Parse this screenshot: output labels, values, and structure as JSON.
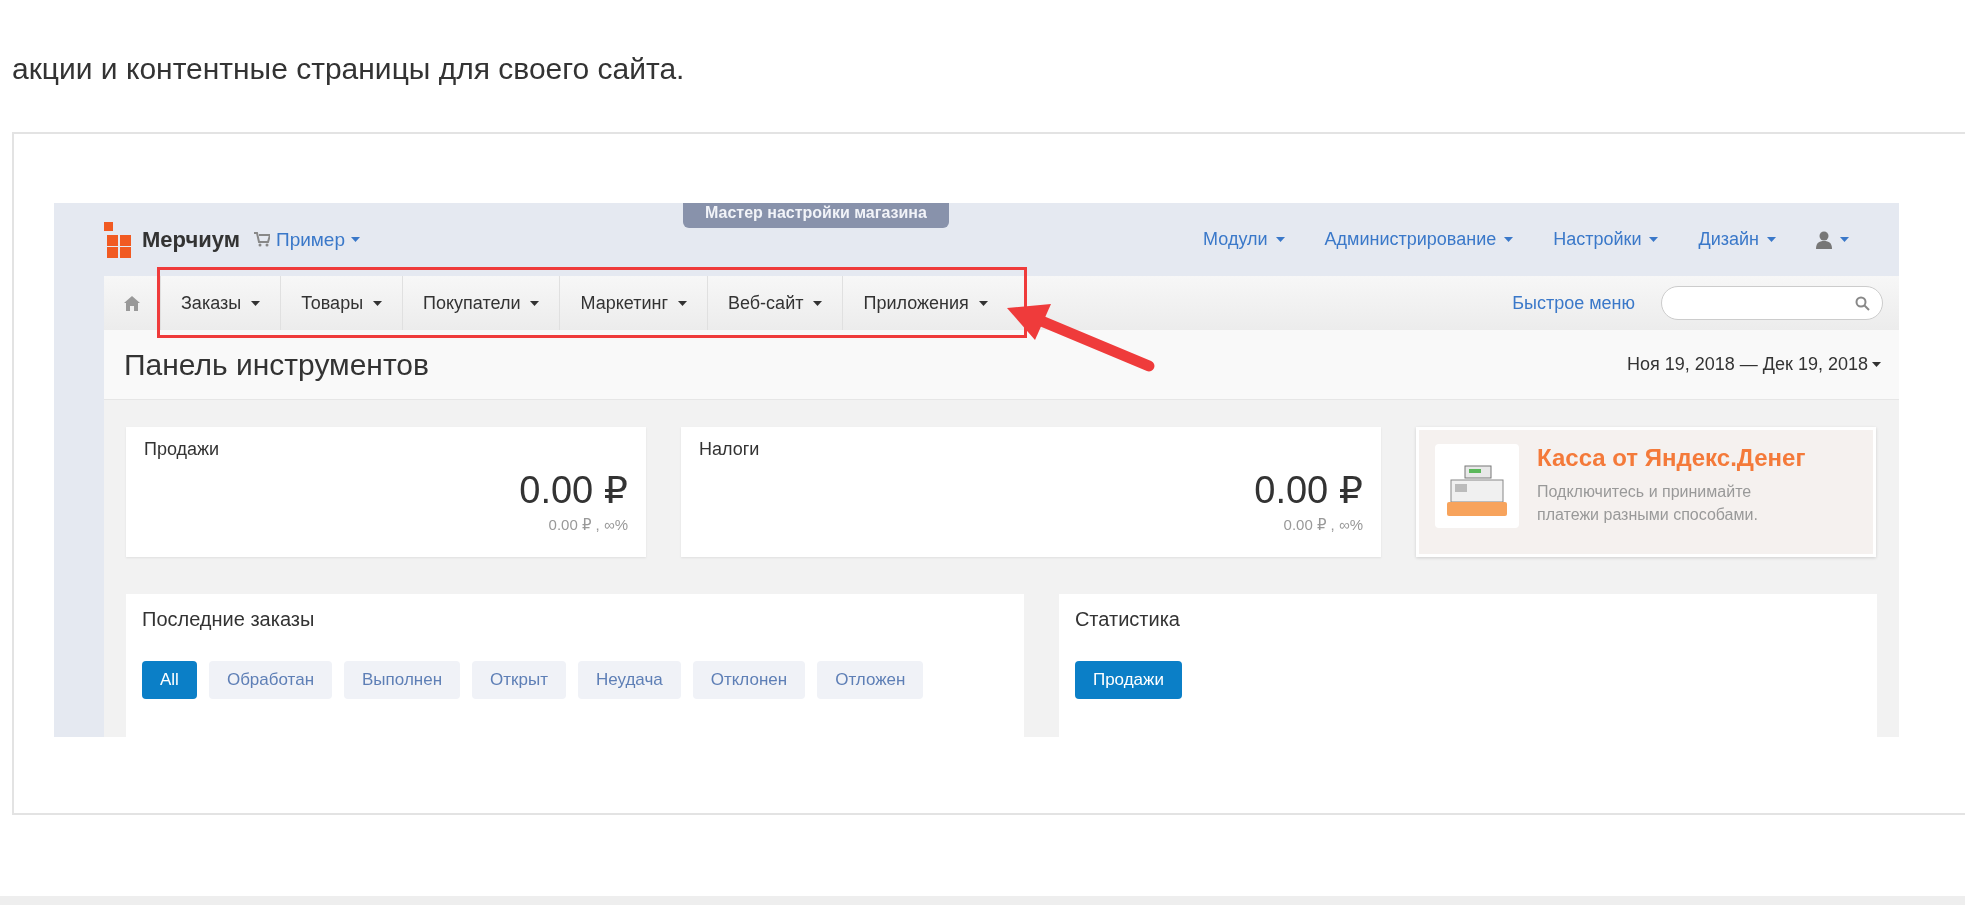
{
  "article": {
    "text": "акции и контентные страницы для своего сайта."
  },
  "screenshot": {
    "wizard_button": "Мастер настройки магазина",
    "brand": "Мерчиум",
    "store": "Пример",
    "top_menu": [
      "Модули",
      "Администрирование",
      "Настройки",
      "Дизайн"
    ],
    "nav": [
      "Заказы",
      "Товары",
      "Покупатели",
      "Маркетинг",
      "Веб-сайт",
      "Приложения"
    ],
    "quick_menu": "Быстрое меню",
    "page_title": "Панель инструментов",
    "date_range": "Ноя 19, 2018 — Дек 19, 2018",
    "stats": [
      {
        "label": "Продажи",
        "value": "0.00 ₽",
        "sub": "0.00 ₽ , ∞%"
      },
      {
        "label": "Налоги",
        "value": "0.00 ₽",
        "sub": "0.00 ₽ , ∞%"
      }
    ],
    "promo": {
      "title": "Касса от Яндекс.Денег",
      "text": "Подключитесь и принимайте платежи разными способами."
    },
    "orders": {
      "title": "Последние заказы",
      "filters": [
        {
          "label": "All",
          "selected": true
        },
        {
          "label": "Обработан",
          "selected": false
        },
        {
          "label": "Выполнен",
          "selected": false
        },
        {
          "label": "Открыт",
          "selected": false
        },
        {
          "label": "Неудача",
          "selected": false
        },
        {
          "label": "Отклонен",
          "selected": false
        },
        {
          "label": "Отложен",
          "selected": false
        }
      ]
    },
    "statistics": {
      "title": "Статистика",
      "tabs": [
        {
          "label": "Продажи",
          "selected": true
        }
      ]
    }
  }
}
